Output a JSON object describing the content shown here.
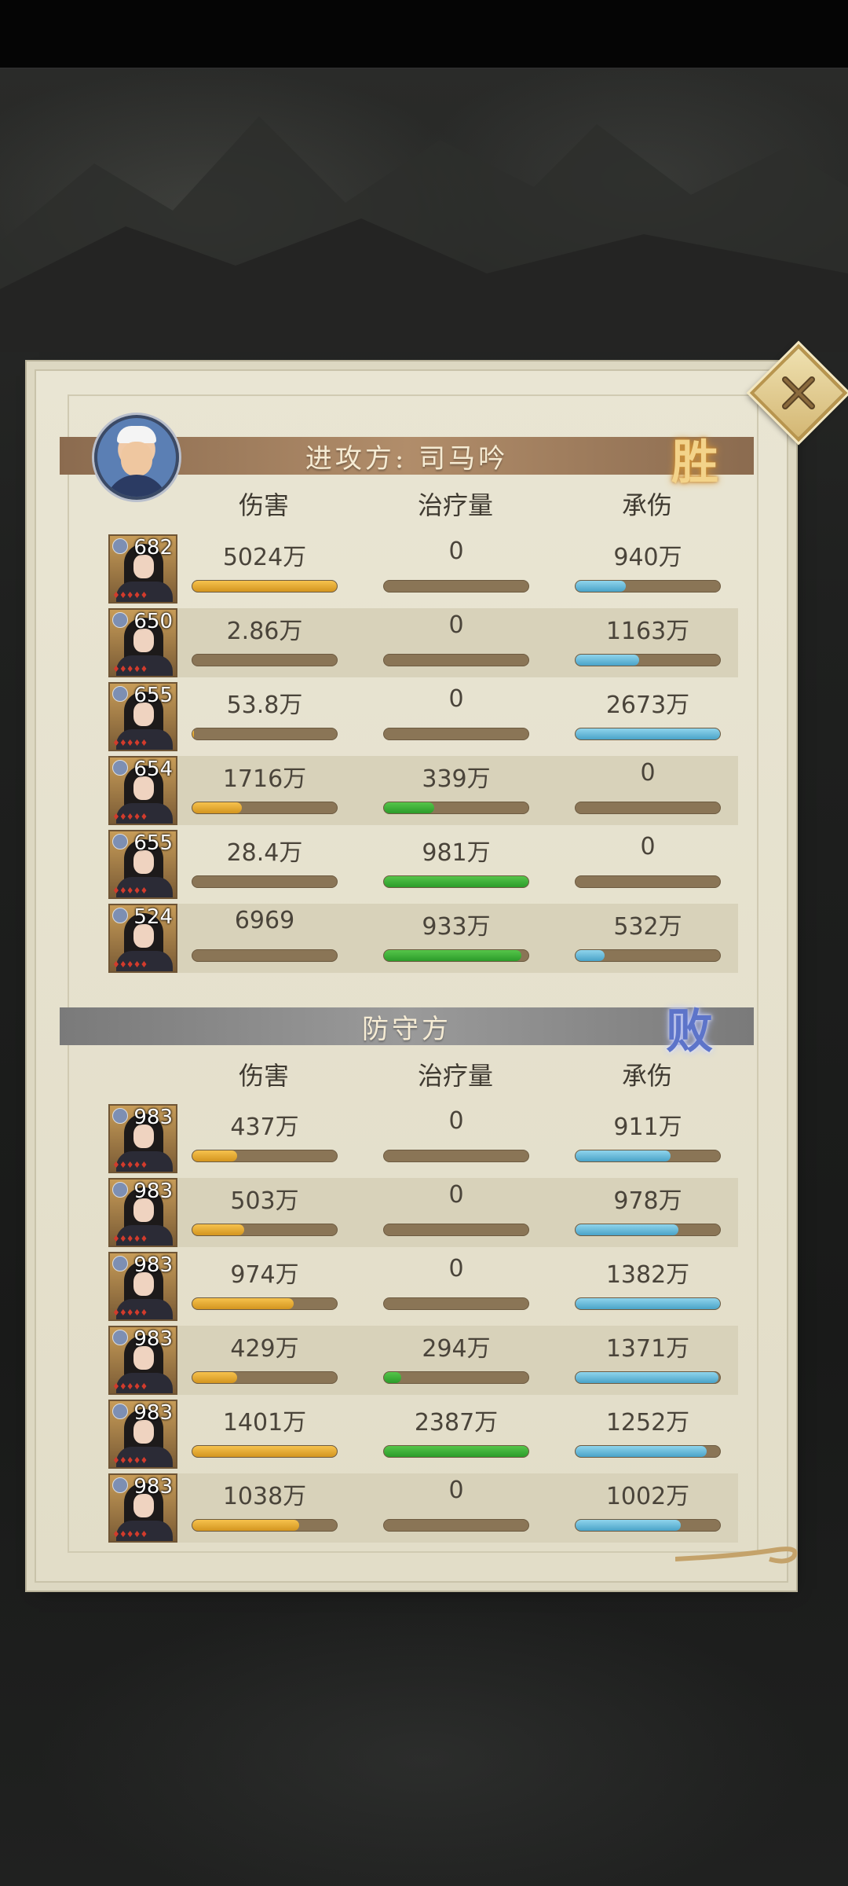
{
  "attacker": {
    "title": "进攻方: 司马吟",
    "result": "胜",
    "columns": [
      "伤害",
      "治疗量",
      "承伤"
    ],
    "rows": [
      {
        "level": "682",
        "damage": "5024万",
        "heal": "0",
        "taken": "940万",
        "damage_ratio": 1.0,
        "heal_ratio": 0.0,
        "taken_ratio": 0.35
      },
      {
        "level": "650",
        "damage": "2.86万",
        "heal": "0",
        "taken": "1163万",
        "damage_ratio": 0.0,
        "heal_ratio": 0.0,
        "taken_ratio": 0.44
      },
      {
        "level": "655",
        "damage": "53.8万",
        "heal": "0",
        "taken": "2673万",
        "damage_ratio": 0.01,
        "heal_ratio": 0.0,
        "taken_ratio": 1.0
      },
      {
        "level": "654",
        "damage": "1716万",
        "heal": "339万",
        "taken": "0",
        "damage_ratio": 0.34,
        "heal_ratio": 0.35,
        "taken_ratio": 0.0
      },
      {
        "level": "655",
        "damage": "28.4万",
        "heal": "981万",
        "taken": "0",
        "damage_ratio": 0.0,
        "heal_ratio": 1.0,
        "taken_ratio": 0.0
      },
      {
        "level": "524",
        "damage": "6969",
        "heal": "933万",
        "taken": "532万",
        "damage_ratio": 0.0,
        "heal_ratio": 0.95,
        "taken_ratio": 0.2
      }
    ]
  },
  "defender": {
    "title": "防守方",
    "result": "败",
    "columns": [
      "伤害",
      "治疗量",
      "承伤"
    ],
    "rows": [
      {
        "level": "983",
        "damage": "437万",
        "heal": "0",
        "taken": "911万",
        "damage_ratio": 0.31,
        "heal_ratio": 0.0,
        "taken_ratio": 0.66
      },
      {
        "level": "983",
        "damage": "503万",
        "heal": "0",
        "taken": "978万",
        "damage_ratio": 0.36,
        "heal_ratio": 0.0,
        "taken_ratio": 0.71
      },
      {
        "level": "983",
        "damage": "974万",
        "heal": "0",
        "taken": "1382万",
        "damage_ratio": 0.7,
        "heal_ratio": 0.0,
        "taken_ratio": 1.0
      },
      {
        "level": "983",
        "damage": "429万",
        "heal": "294万",
        "taken": "1371万",
        "damage_ratio": 0.31,
        "heal_ratio": 0.12,
        "taken_ratio": 0.99
      },
      {
        "level": "983",
        "damage": "1401万",
        "heal": "2387万",
        "taken": "1252万",
        "damage_ratio": 1.0,
        "heal_ratio": 1.0,
        "taken_ratio": 0.91
      },
      {
        "level": "983",
        "damage": "1038万",
        "heal": "0",
        "taken": "1002万",
        "damage_ratio": 0.74,
        "heal_ratio": 0.0,
        "taken_ratio": 0.73
      }
    ]
  },
  "colors": {
    "damage_bar": "#e2a737",
    "heal_bar": "#3eb03a",
    "taken_bar": "#6cbedc",
    "win": "#f3d38a",
    "lose": "#5d74c9"
  },
  "icons": {
    "close": "close-x-icon",
    "avatar": "commander-avatar"
  }
}
